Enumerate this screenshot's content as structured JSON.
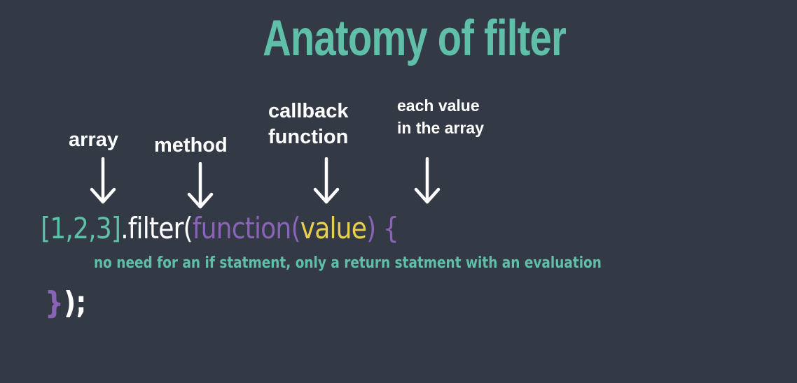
{
  "title": "Anatomy of filter",
  "labels": {
    "array": "array",
    "method": "method",
    "callback_line1": "callback",
    "callback_line2": "function",
    "each_line1": "each value",
    "each_line2": "in the array"
  },
  "code": {
    "array": "[1,2,3]",
    "method": ".filter(",
    "function_keyword": "function(",
    "param": "value",
    "function_close": ") {",
    "note": "no need for an if statment, only a return statment with an evaluation",
    "closing_brace": "}",
    "closing_rest": ");"
  },
  "colors": {
    "background": "#343a45",
    "teal": "#5fbfa8",
    "purple": "#8a63b8",
    "yellow": "#e8cf52",
    "white": "#ffffff"
  },
  "icons": [
    "arrow-down-icon"
  ]
}
